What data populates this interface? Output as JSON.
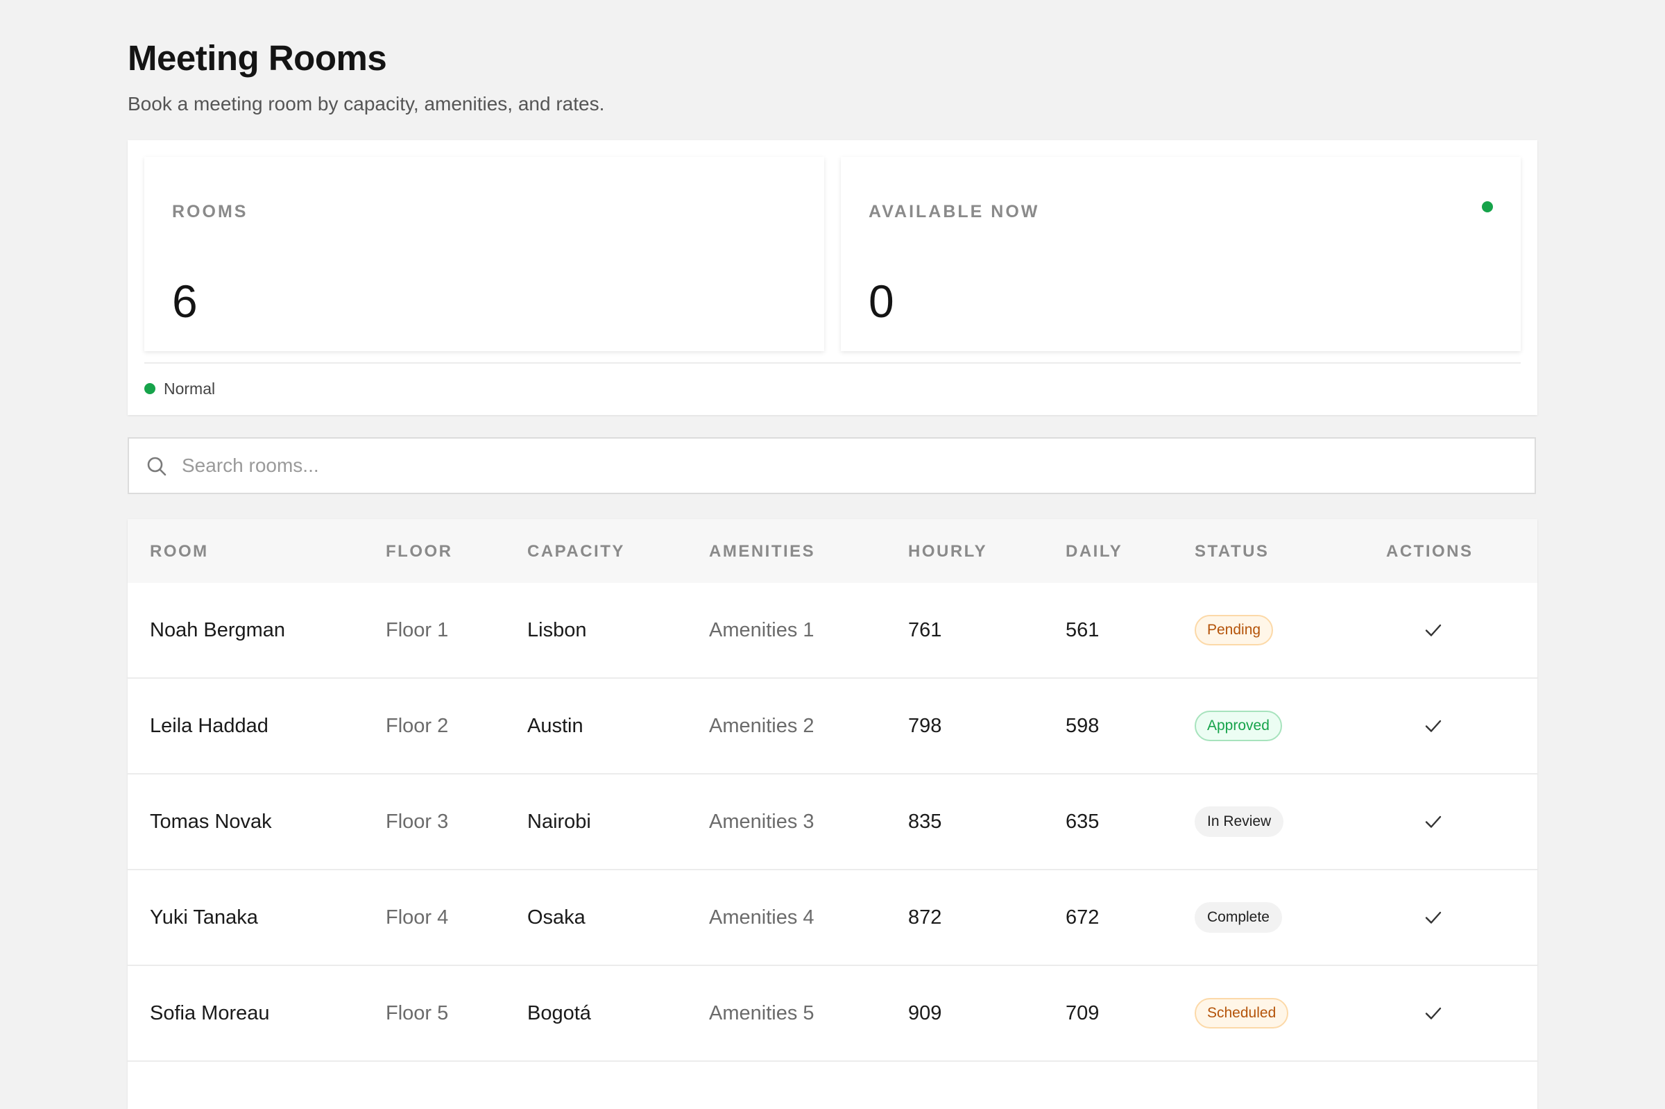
{
  "page": {
    "title": "Meeting Rooms",
    "subtitle": "Book a meeting room by capacity, amenities, and rates."
  },
  "stats": {
    "rooms": {
      "label": "ROOMS",
      "value": "6"
    },
    "available": {
      "label": "AVAILABLE NOW",
      "value": "0"
    },
    "status": {
      "text": "Normal",
      "color": "#16a34a"
    }
  },
  "search": {
    "placeholder": "Search rooms...",
    "value": ""
  },
  "table": {
    "columns": {
      "room": "ROOM",
      "floor": "FLOOR",
      "capacity": "CAPACITY",
      "amenities": "AMENITIES",
      "hourly": "HOURLY",
      "daily": "DAILY",
      "status": "STATUS",
      "actions": "ACTIONS"
    },
    "rows": [
      {
        "room": "Noah Bergman",
        "floor": "Floor 1",
        "capacity": "Lisbon",
        "amenities": "Amenities 1",
        "hourly": "761",
        "daily": "561",
        "status": "Pending",
        "status_kind": "pending"
      },
      {
        "room": "Leila Haddad",
        "floor": "Floor 2",
        "capacity": "Austin",
        "amenities": "Amenities 2",
        "hourly": "798",
        "daily": "598",
        "status": "Approved",
        "status_kind": "approved"
      },
      {
        "room": "Tomas Novak",
        "floor": "Floor 3",
        "capacity": "Nairobi",
        "amenities": "Amenities 3",
        "hourly": "835",
        "daily": "635",
        "status": "In Review",
        "status_kind": "review"
      },
      {
        "room": "Yuki Tanaka",
        "floor": "Floor 4",
        "capacity": "Osaka",
        "amenities": "Amenities 4",
        "hourly": "872",
        "daily": "672",
        "status": "Complete",
        "status_kind": "complete"
      },
      {
        "room": "Sofia Moreau",
        "floor": "Floor 5",
        "capacity": "Bogotá",
        "amenities": "Amenities 5",
        "hourly": "909",
        "daily": "709",
        "status": "Scheduled",
        "status_kind": "scheduled"
      }
    ],
    "action_icon": "check-icon"
  },
  "colors": {
    "accent_green": "#16a34a",
    "warning_orange": "#b45309"
  }
}
